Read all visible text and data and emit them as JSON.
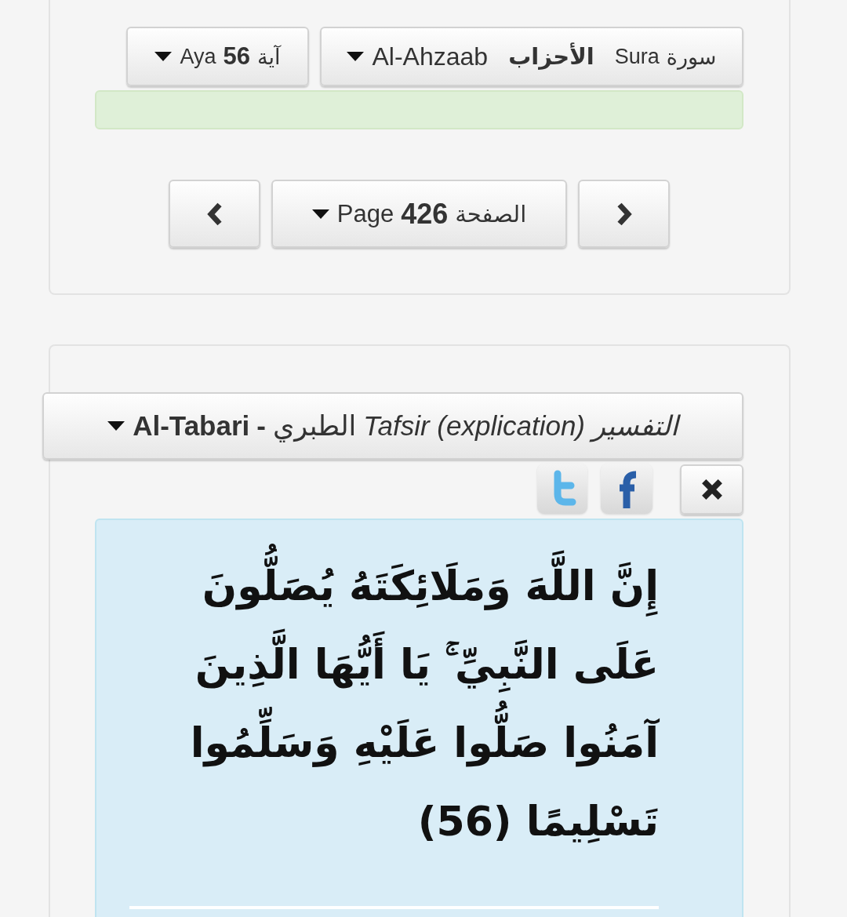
{
  "selectors": {
    "aya": {
      "label_en": "Aya",
      "value": "56",
      "label_ar": "آية"
    },
    "sura": {
      "name_en": "Al-Ahzaab",
      "name_ar": "الأحزاب",
      "label_en": "Sura",
      "label_ar": "سورة"
    }
  },
  "page_nav": {
    "page": {
      "label_en": "Page",
      "value": "426",
      "label_ar": "الصفحة"
    }
  },
  "tafsir": {
    "selector": {
      "author_en": "Al-Tabari",
      "separator": "-",
      "author_ar": "الطبري",
      "label_en": "Tafsir (explication)",
      "label_ar": "التفسير"
    },
    "verse": "إِنَّ اللَّهَ وَمَلَائِكَتَهُ يُصَلُّونَ عَلَى النَّبِيِّ ۚ يَا أَيُّهَا الَّذِينَ آمَنُوا صَلُّوا عَلَيْهِ وَسَلِّمُوا تَسْلِيمًا (56)"
  }
}
